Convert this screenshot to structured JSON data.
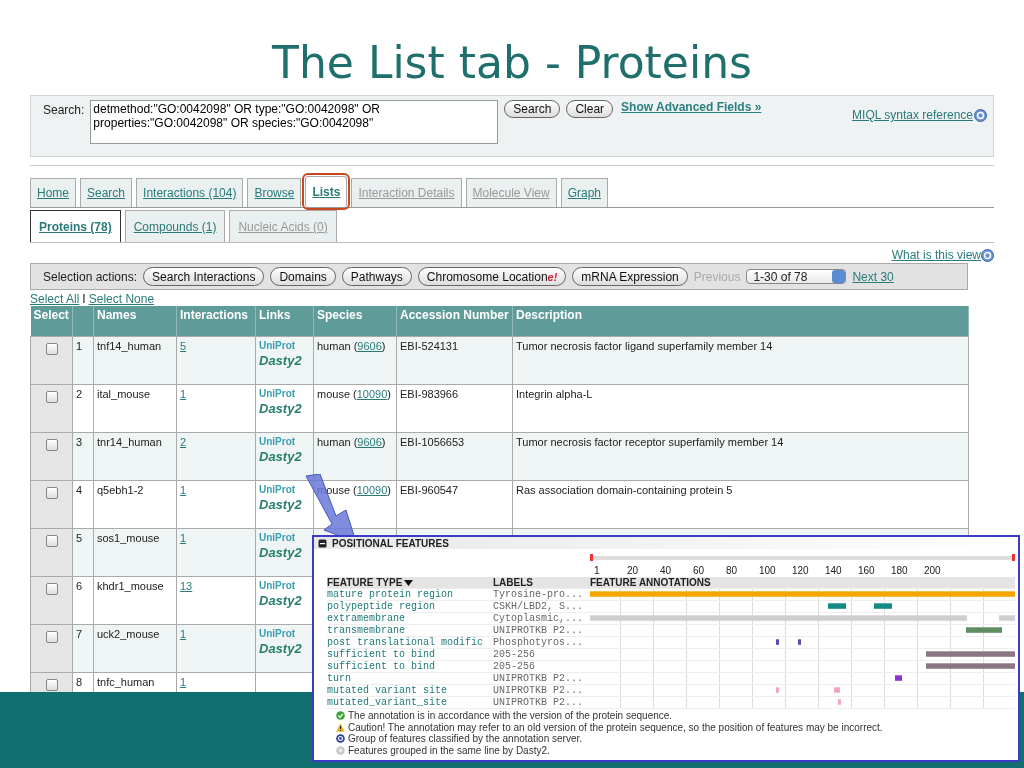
{
  "slide_title": "The List tab - Proteins",
  "search": {
    "label": "Search:",
    "value": "detmethod:\"GO:0042098\" OR type:\"GO:0042098\" OR properties:\"GO:0042098\" OR species:\"GO:0042098\"",
    "buttons": [
      "Search",
      "Clear"
    ],
    "advanced_link": "Show Advanced Fields »",
    "syntax_link": "MIQL syntax reference"
  },
  "tabs": [
    {
      "label": "Home",
      "selected": false,
      "disabled": false,
      "highlighted": false
    },
    {
      "label": "Search",
      "selected": false,
      "disabled": false,
      "highlighted": false
    },
    {
      "label": "Interactions (104)",
      "selected": false,
      "disabled": false,
      "highlighted": false
    },
    {
      "label": "Browse",
      "selected": false,
      "disabled": false,
      "highlighted": false
    },
    {
      "label": "Lists",
      "selected": true,
      "disabled": false,
      "highlighted": true
    },
    {
      "label": "Interaction Details",
      "selected": false,
      "disabled": true,
      "highlighted": false
    },
    {
      "label": "Molecule View",
      "selected": false,
      "disabled": true,
      "highlighted": false
    },
    {
      "label": "Graph",
      "selected": false,
      "disabled": false,
      "highlighted": false
    }
  ],
  "subtabs": [
    {
      "label": "Proteins (78)",
      "selected": true,
      "disabled": false
    },
    {
      "label": "Compounds (1)",
      "selected": false,
      "disabled": false
    },
    {
      "label": "Nucleic Acids (0)",
      "selected": false,
      "disabled": true
    }
  ],
  "help_link": "What is this view",
  "selection_bar": {
    "label": "Selection actions:",
    "buttons": [
      {
        "label": "Search Interactions"
      },
      {
        "label": "Domains"
      },
      {
        "label": "Pathways"
      },
      {
        "label": "Chromosome Location",
        "badge": "e!"
      },
      {
        "label": "mRNA Expression"
      }
    ],
    "previous": "Previous",
    "page_select": "1-30 of 78",
    "next": "Next 30"
  },
  "select_links": {
    "all": "Select All",
    "separator": "I",
    "none": "Select None"
  },
  "table": {
    "columns": [
      "Select",
      "",
      "Names",
      "Interactions",
      "Links",
      "Species",
      "Accession Number",
      "Description"
    ],
    "rows": [
      {
        "checked": false,
        "index": "1",
        "name": "tnf14_human",
        "interactions": "5",
        "links": [
          "UniProt",
          "Dasty2"
        ],
        "species": "human (",
        "taxid": "9606",
        "species_end": ")",
        "accession": "EBI-524131",
        "description": "Tumor necrosis factor ligand superfamily member 14"
      },
      {
        "checked": false,
        "index": "2",
        "name": "ital_mouse",
        "interactions": "1",
        "links": [
          "UniProt",
          "Dasty2"
        ],
        "species": "mouse (",
        "taxid": "10090",
        "species_end": ")",
        "accession": "EBI-983966",
        "description": "Integrin alpha-L"
      },
      {
        "checked": false,
        "index": "3",
        "name": "tnr14_human",
        "interactions": "2",
        "links": [
          "UniProt",
          "Dasty2"
        ],
        "species": "human (",
        "taxid": "9606",
        "species_end": ")",
        "accession": "EBI-1056653",
        "description": "Tumor necrosis factor receptor superfamily member 14"
      },
      {
        "checked": false,
        "index": "4",
        "name": "q5ebh1-2",
        "interactions": "1",
        "links": [
          "UniProt",
          "Dasty2"
        ],
        "species": "mouse (",
        "taxid": "10090",
        "species_end": ")",
        "accession": "EBI-960547",
        "description": "Ras association domain-containing protein 5"
      },
      {
        "checked": false,
        "index": "5",
        "name": "sos1_mouse",
        "interactions": "1",
        "links": [
          "UniProt",
          "Dasty2"
        ]
      },
      {
        "checked": false,
        "index": "6",
        "name": "khdr1_mouse",
        "interactions": "13",
        "links": [
          "UniProt",
          "Dasty2"
        ]
      },
      {
        "checked": false,
        "index": "7",
        "name": "uck2_mouse",
        "interactions": "1",
        "links": [
          "UniProt",
          "Dasty2"
        ]
      },
      {
        "checked": false,
        "index": "8",
        "name": "tnfc_human",
        "interactions": "1"
      }
    ]
  },
  "positional_features": {
    "title": "POSITIONAL FEATURES",
    "ticks": [
      "1",
      "20",
      "40",
      "60",
      "80",
      "100",
      "120",
      "140",
      "160",
      "180",
      "200"
    ],
    "columns": [
      "FEATURE TYPE",
      "LABELS",
      "FEATURE ANNOTATIONS"
    ],
    "rows": [
      {
        "type": "mature protein region",
        "label": "Tyrosine-pro..."
      },
      {
        "type": "polypeptide region",
        "label": "CSKH/LBD2, S..."
      },
      {
        "type": "extramembrane",
        "label": "Cytoplasmic,..."
      },
      {
        "type": "transmembrane",
        "label": "UNIPROTKB P2..."
      },
      {
        "type": "post translational modific",
        "label": "Phosphotyros..."
      },
      {
        "type": "sufficient to bind",
        "label": "205-256"
      },
      {
        "type": "sufficient to bind",
        "label": "205-256"
      },
      {
        "type": "turn",
        "label": "UNIPROTKB P2..."
      },
      {
        "type": "mutated variant site",
        "label": "UNIPROTKB P2..."
      },
      {
        "type": "mutated_variant_site",
        "label": "UNIPROTKB P2..."
      }
    ],
    "legend": [
      {
        "kind": "ok",
        "text": "The annotation is in accordance with the version of the protein sequence."
      },
      {
        "kind": "warning",
        "text": "Caution! The annotation may refer to an old version of the protein sequence, so the position of features may be incorrect."
      },
      {
        "kind": "group",
        "text": "Group of features classified by the annotation server."
      },
      {
        "kind": "dasty",
        "text": "Features grouped in the same line by Dasty2."
      }
    ]
  }
}
